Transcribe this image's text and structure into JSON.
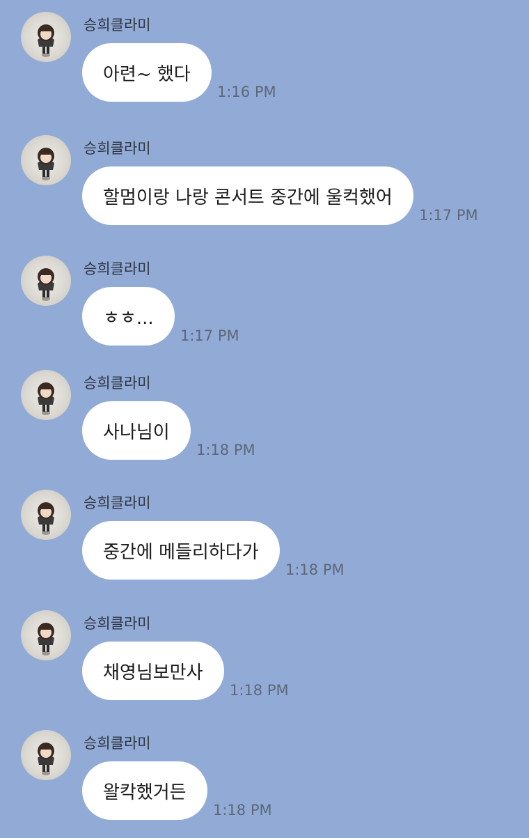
{
  "chat": {
    "messages": [
      {
        "sender": "승희클라미",
        "text": "아련~ 했다",
        "time": "1:16 PM",
        "avatar": "profile-photo"
      },
      {
        "sender": "승희클라미",
        "text": "할멈이랑 나랑 콘서트 중간에 울컥했어",
        "time": "1:17 PM",
        "avatar": "profile-photo"
      },
      {
        "sender": "승희클라미",
        "text": "ㅎㅎ...",
        "time": "1:17 PM",
        "avatar": "profile-photo"
      },
      {
        "sender": "승희클라미",
        "text": "사나님이",
        "time": "1:18 PM",
        "avatar": "profile-photo"
      },
      {
        "sender": "승희클라미",
        "text": "중간에 메들리하다가",
        "time": "1:18 PM",
        "avatar": "profile-photo"
      },
      {
        "sender": "승희클라미",
        "text": "채영님보만사",
        "time": "1:18 PM",
        "avatar": "profile-photo"
      },
      {
        "sender": "승희클라미",
        "text": "왈칵했거든",
        "time": "1:18 PM",
        "avatar": "profile-photo"
      }
    ]
  },
  "colors": {
    "background": "#92abd6",
    "bubble": "#ffffff",
    "sender_text": "#2f3542",
    "time_text": "#5d6779"
  }
}
